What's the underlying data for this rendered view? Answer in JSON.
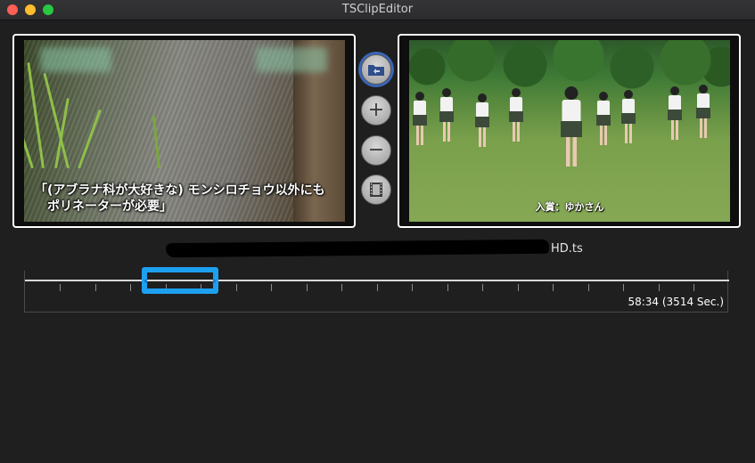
{
  "window": {
    "title": "TSClipEditor"
  },
  "preview_left": {
    "caption": "「(アブラナ科が大好きな) モンシロチョウ以外にも\n　ポリネーターが必要」"
  },
  "preview_right": {
    "caption": "入賞：ゆかさん"
  },
  "side_buttons": {
    "add_symbol": "+",
    "remove_symbol": "−",
    "folder_icon": "folder-return-icon",
    "film_icon": "film-strip-icon"
  },
  "file": {
    "name_suffix": "HD.ts"
  },
  "timeline": {
    "duration": "58:34 (3514 Sec.)",
    "selection_color": "#1ea0f0"
  }
}
